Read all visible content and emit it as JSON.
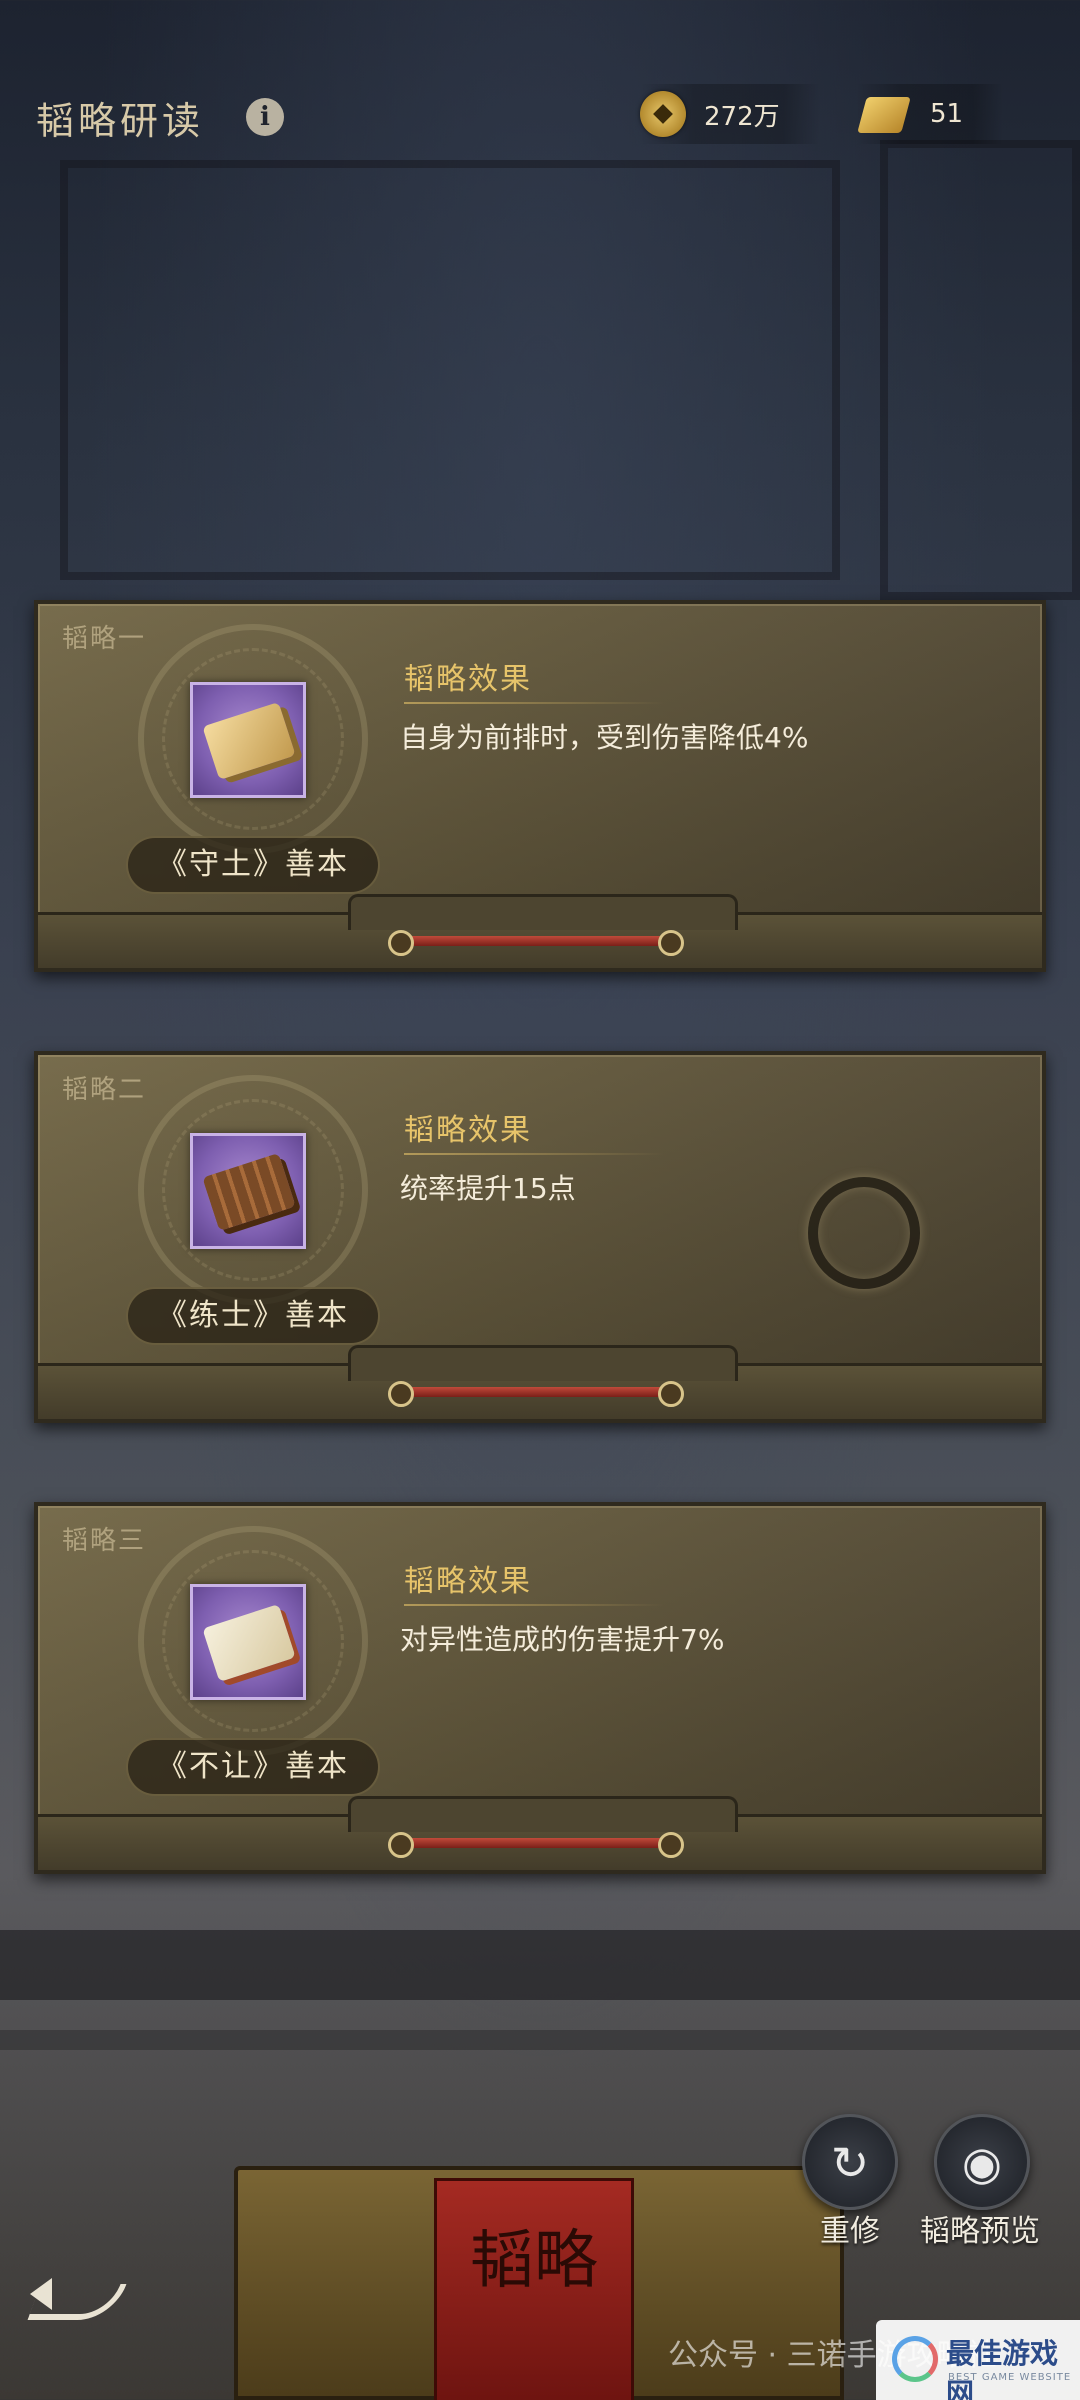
{
  "header": {
    "title": "韬略研读",
    "info_icon": "info-icon",
    "resources": [
      {
        "icon": "coin-icon",
        "value": "272万"
      },
      {
        "icon": "scroll-icon",
        "value": "51"
      }
    ]
  },
  "cards": [
    {
      "label": "韬略一",
      "book": "《守土》善本",
      "effect_title": "韬略效果",
      "effect": "自身为前排时，受到伤害降低4%",
      "item_icon": "scroll-bundle-icon"
    },
    {
      "label": "韬略二",
      "book": "《练士》善本",
      "effect_title": "韬略效果",
      "effect": "统率提升15点",
      "item_icon": "bamboo-slip-icon",
      "extra_icon": "ring-icon"
    },
    {
      "label": "韬略三",
      "book": "《不让》善本",
      "effect_title": "韬略效果",
      "effect": "对异性造成的伤害提升7%",
      "item_icon": "paper-scroll-icon"
    }
  ],
  "actions": {
    "reforge_label": "重修",
    "preview_label": "韬略预览"
  },
  "box_seal_text": "韬略",
  "watermark": "公众号 · 三诺手游攻略社",
  "site_logo": {
    "title": "最佳游戏网",
    "subtitle": "BEST GAME WEBSITE"
  }
}
